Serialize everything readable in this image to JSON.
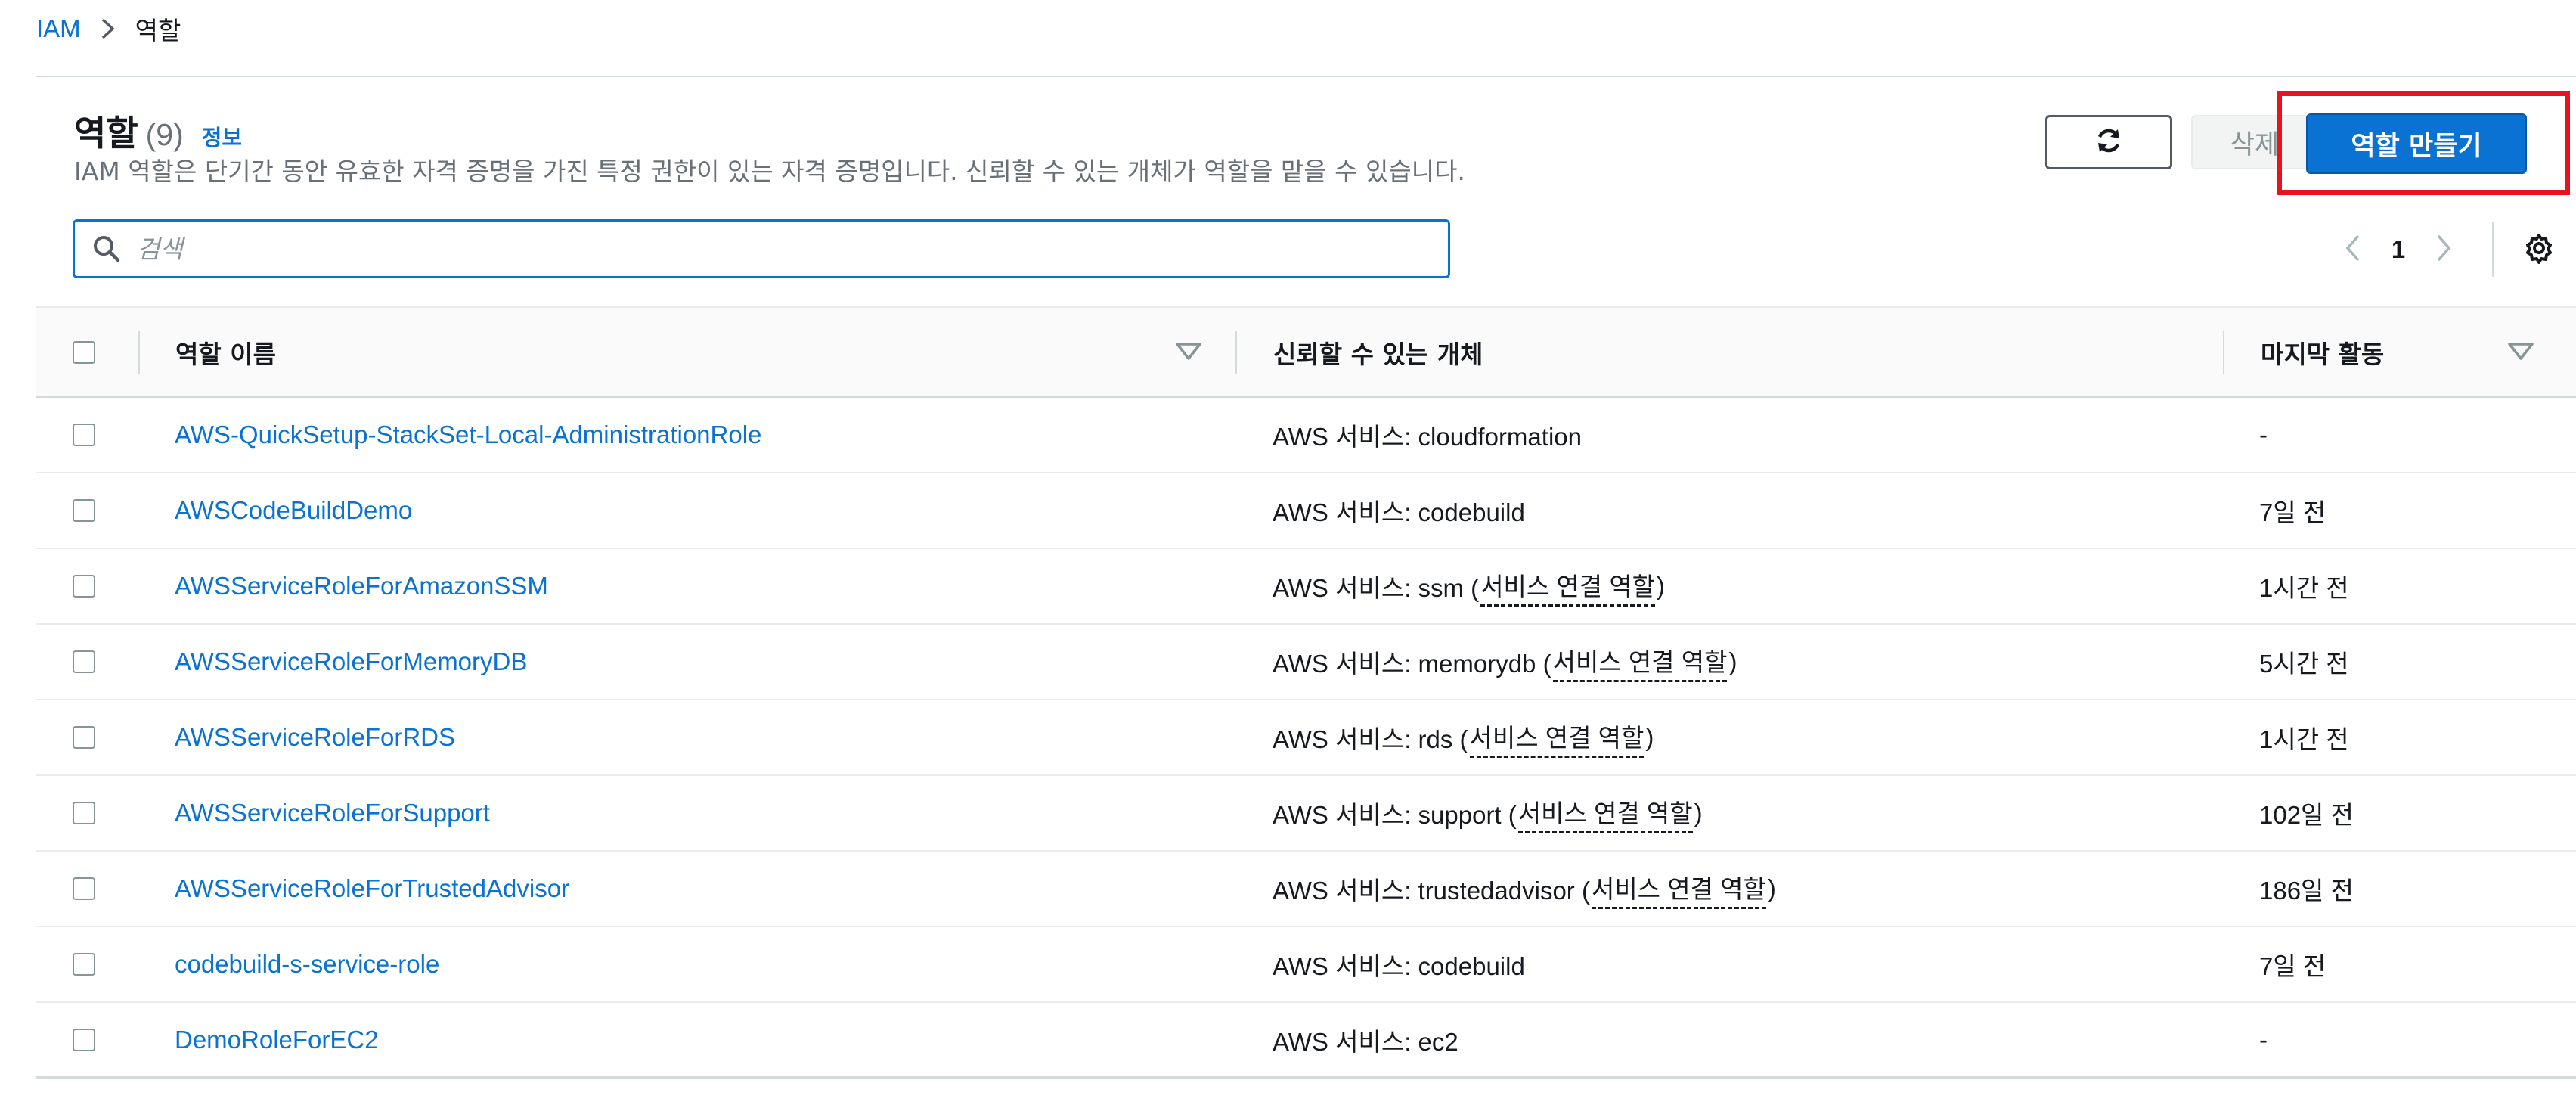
{
  "breadcrumb": {
    "root": "IAM",
    "current": "역할"
  },
  "header": {
    "title": "역할",
    "count": "(9)",
    "info_link": "정보",
    "description": "IAM 역할은 단기간 동안 유효한 자격 증명을 가진 특정 권한이 있는 자격 증명입니다. 신뢰할 수 있는 개체가 역할을 맡을 수 있습니다."
  },
  "actions": {
    "refresh_icon": "refresh-icon",
    "delete_label": "삭제",
    "create_label": "역할 만들기"
  },
  "search": {
    "placeholder": "검색",
    "value": ""
  },
  "pagination": {
    "current_page": "1"
  },
  "table": {
    "columns": {
      "name": "역할 이름",
      "trusted": "신뢰할 수 있는 개체",
      "last_activity": "마지막 활동"
    },
    "rows": [
      {
        "name": "AWS-QuickSetup-StackSet-Local-AdministrationRole",
        "trusted_prefix": "AWS 서비스: cloudformation",
        "linked": "",
        "last_activity": "-"
      },
      {
        "name": "AWSCodeBuildDemo",
        "trusted_prefix": "AWS 서비스: codebuild",
        "linked": "",
        "last_activity": "7일 전"
      },
      {
        "name": "AWSServiceRoleForAmazonSSM",
        "trusted_prefix": "AWS 서비스: ssm (",
        "linked": "서비스 연결 역할",
        "last_activity": "1시간 전"
      },
      {
        "name": "AWSServiceRoleForMemoryDB",
        "trusted_prefix": "AWS 서비스: memorydb (",
        "linked": "서비스 연결 역할",
        "last_activity": "5시간 전"
      },
      {
        "name": "AWSServiceRoleForRDS",
        "trusted_prefix": "AWS 서비스: rds (",
        "linked": "서비스 연결 역할",
        "last_activity": "1시간 전"
      },
      {
        "name": "AWSServiceRoleForSupport",
        "trusted_prefix": "AWS 서비스: support (",
        "linked": "서비스 연결 역할",
        "last_activity": "102일 전"
      },
      {
        "name": "AWSServiceRoleForTrustedAdvisor",
        "trusted_prefix": "AWS 서비스: trustedadvisor (",
        "linked": "서비스 연결 역할",
        "last_activity": "186일 전"
      },
      {
        "name": "codebuild-s-service-role",
        "trusted_prefix": "AWS 서비스: codebuild",
        "linked": "",
        "last_activity": "7일 전"
      },
      {
        "name": "DemoRoleForEC2",
        "trusted_prefix": "AWS 서비스: ec2",
        "linked": "",
        "last_activity": "-"
      }
    ]
  },
  "colors": {
    "link": "#0972d3",
    "primary_button": "#0972d3",
    "highlight": "#e8131c"
  }
}
